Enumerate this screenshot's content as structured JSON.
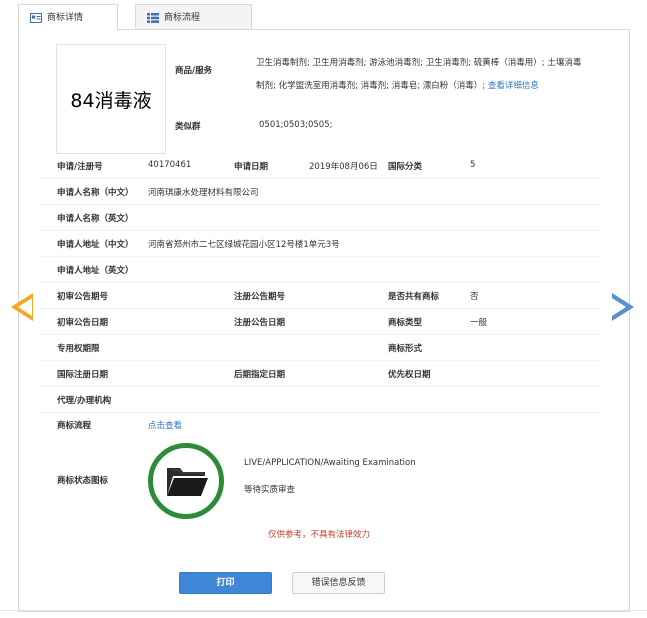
{
  "tabs": [
    {
      "label": "商标详情",
      "icon": "id-card-icon",
      "active": true
    },
    {
      "label": "商标流程",
      "icon": "list-icon",
      "active": false
    }
  ],
  "trademark": {
    "name": "84消毒液",
    "goods_label": "商品/服务",
    "goods_text": "卫生消毒制剂; 卫生用消毒剂; 游泳池消毒剂; 卫生消毒剂; 硫黄棒（消毒用）; 土壤消毒制剂; 化学盥洗室用消毒剂; 消毒剂; 消毒皂; 漂白粉（消毒）;",
    "goods_more_link": "查看详细信息",
    "similar_group_label": "类似群",
    "similar_group": "0501;0503;0505;"
  },
  "fields": {
    "reg_no_label": "申请/注册号",
    "reg_no": "40170461",
    "app_date_label": "申请日期",
    "app_date": "2019年08月06日",
    "intl_class_label": "国际分类",
    "intl_class": "5",
    "applicant_cn_label": "申请人名称（中文）",
    "applicant_cn": "河南琪康水处理材料有限公司",
    "applicant_en_label": "申请人名称（英文）",
    "applicant_en": "",
    "address_cn_label": "申请人地址（中文）",
    "address_cn": "河南省郑州市二七区绿城花园小区12号楼1单元3号",
    "address_en_label": "申请人地址（英文）",
    "address_en": "",
    "prelim_no_label": "初审公告期号",
    "reg_pub_no_label": "注册公告期号",
    "shared_label": "是否共有商标",
    "shared": "否",
    "prelim_date_label": "初审公告日期",
    "reg_pub_date_label": "注册公告日期",
    "tm_type_label": "商标类型",
    "tm_type": "一般",
    "exclusive_label": "专用权期限",
    "tm_form_label": "商标形式",
    "intl_reg_date_label": "国际注册日期",
    "later_date_label": "后期指定日期",
    "priority_date_label": "优先权日期",
    "agent_label": "代理/办理机构",
    "process_label": "商标流程",
    "process_link": "点击查看",
    "status_icon_label": "商标状态图标",
    "status_en": "LIVE/APPLICATION/Awaiting Examination",
    "status_cn": "等待实质审查"
  },
  "disclaimer": "仅供参考，不具有法律效力",
  "buttons": {
    "print": "打印",
    "feedback": "错误信息反馈"
  },
  "icons": {
    "prev": "chevron-left-icon",
    "next": "chevron-right-icon",
    "status": "folder-icon"
  },
  "colors": {
    "link": "#2f76c2",
    "primary_button": "#3f86d6",
    "status_ring": "#2e8b3a",
    "prev_arrow": "#f5a623",
    "next_arrow": "#5a8fd0",
    "disclaimer": "#c0392b"
  }
}
